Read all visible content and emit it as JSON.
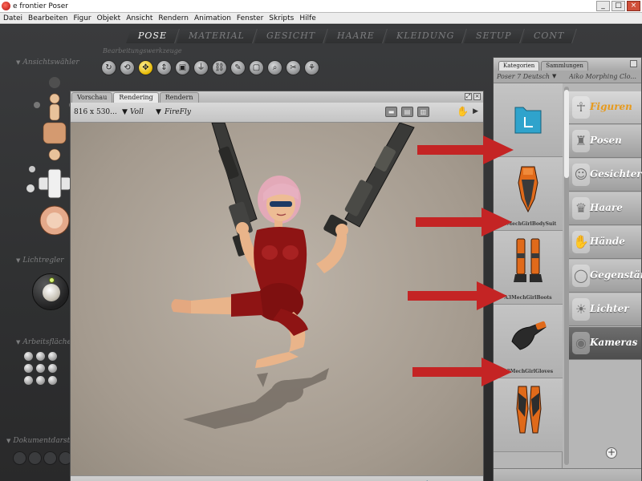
{
  "window": {
    "title": "e frontier Poser",
    "min": "_",
    "max": "□",
    "close": "×"
  },
  "menu": [
    "Datei",
    "Bearbeiten",
    "Figur",
    "Objekt",
    "Ansicht",
    "Rendern",
    "Animation",
    "Fenster",
    "Skripts",
    "Hilfe"
  ],
  "rooms": [
    "POSE",
    "MATERIAL",
    "GESICHT",
    "HAARE",
    "KLEIDUNG",
    "SETUP",
    "CONT"
  ],
  "active_room": "POSE",
  "tools": {
    "label": "Bearbeitungswerkzeuge",
    "icons": [
      "rotate-icon",
      "twist-icon",
      "translate-icon",
      "translate-in-out-icon",
      "scale-icon",
      "taper-icon",
      "chain-break-icon",
      "color-icon",
      "grouping-icon",
      "view-magnifier-icon",
      "morphing-icon",
      "direct-manipulation-icon"
    ],
    "glyphs": [
      "↻",
      "⟲",
      "✥",
      "⇕",
      "▣",
      "⏚",
      "⛓",
      "✎",
      "▢",
      "⌕",
      "✂",
      "⚘"
    ]
  },
  "left": {
    "camera_label": "Ansichtswähler",
    "light_label": "Lichtregler",
    "workspace_label": "Arbeitsfläche",
    "document_label": "Dokumentdarst"
  },
  "document": {
    "tabs": [
      "Vorschau",
      "Rendering",
      "Rendern"
    ],
    "active_tab": "Rendering",
    "size": "816 x 530...",
    "quality": "Voll",
    "engine": "FireFly",
    "slider": 0.94
  },
  "library": {
    "tabs": [
      "Kategorien",
      "Sammlungen"
    ],
    "active_tab": "Kategorien",
    "runtime": "Poser 7 Deutsch",
    "folder": "Aiko Morphing Clo...",
    "items": [
      "",
      "A3MechGirlBodySuit",
      "A3MechGirlBoots",
      "A3MechGirlGloves",
      ""
    ],
    "categories": [
      "Figuren",
      "Posen",
      "Gesichter",
      "Haare",
      "Hände",
      "Gegenstände",
      "Lichter",
      "Kameras"
    ],
    "active_category": "Figuren",
    "category_icons": [
      "figure-icon",
      "pose-icon",
      "face-icon",
      "hair-icon",
      "hand-icon",
      "props-icon",
      "light-icon",
      "camera-icon"
    ],
    "category_glyphs": [
      "☥",
      "♜",
      "☺",
      "♛",
      "✋",
      "◯",
      "☀",
      "◉"
    ]
  },
  "colors": {
    "annotation_arrow": "#c42424",
    "active_category": "#e79a1c",
    "slider_thumb": "#2aa7c8",
    "suit_red": "#8e1414",
    "suit_orange": "#e06a1a"
  }
}
